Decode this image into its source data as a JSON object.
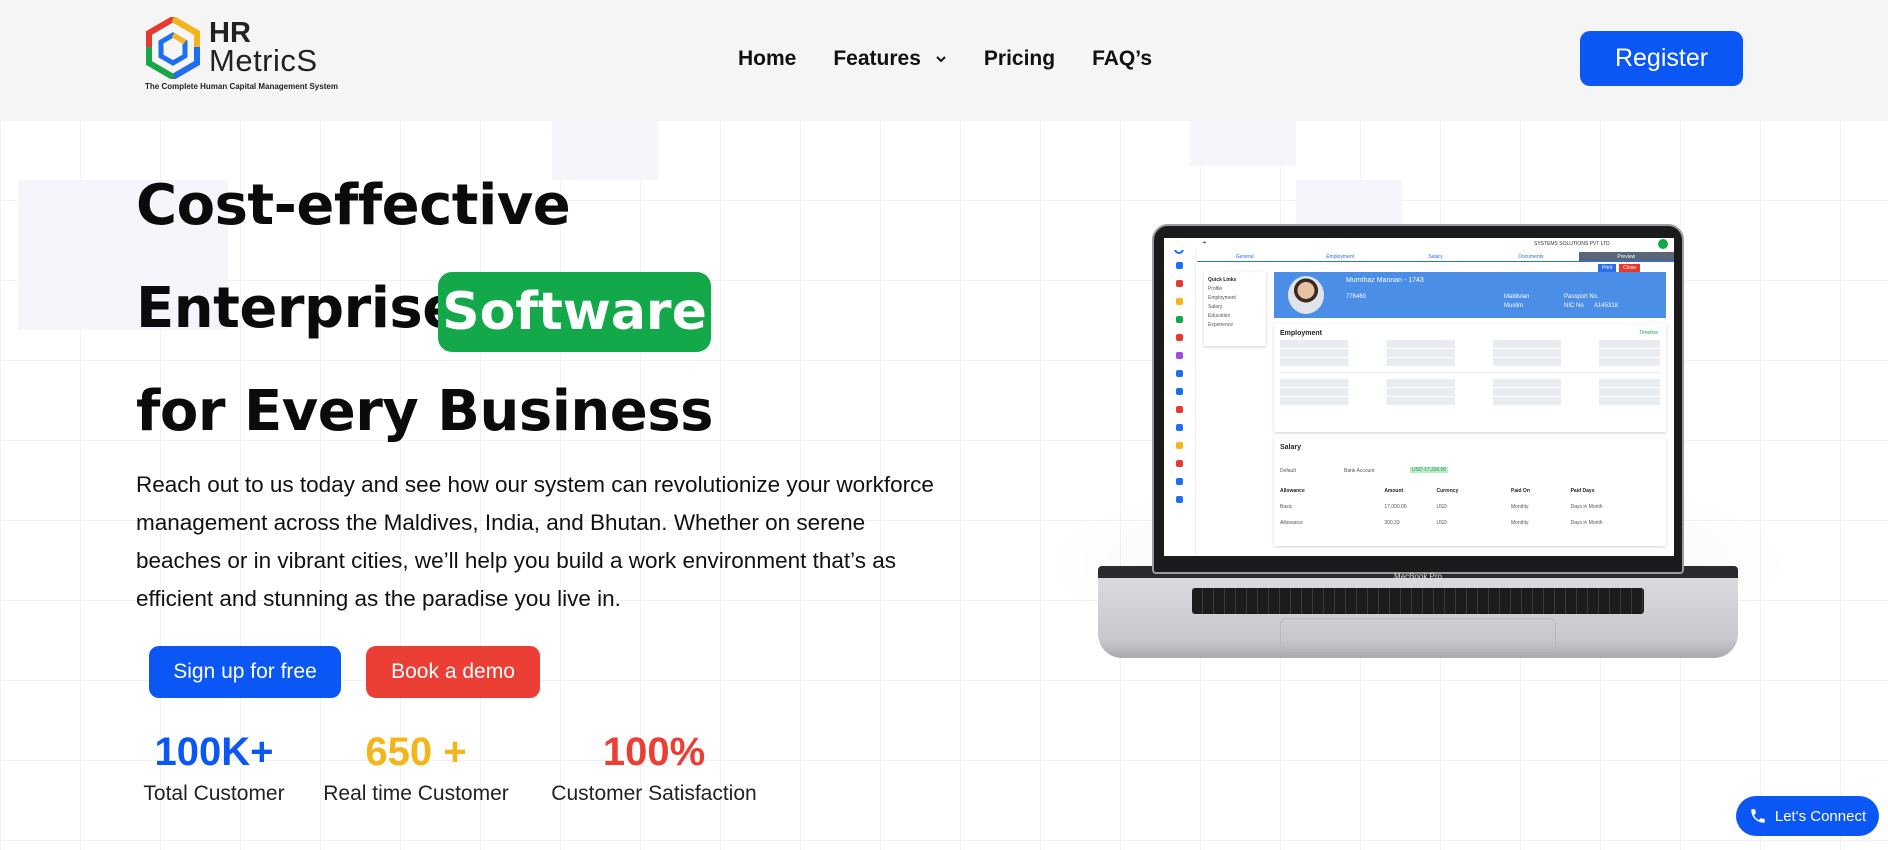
{
  "header": {
    "logo": {
      "hr": "HR",
      "metrics": "MetricS",
      "tagline": "The Complete Human Capital Management System"
    },
    "nav": [
      {
        "label": "Home"
      },
      {
        "label": "Features",
        "has_dropdown": true,
        "icon": "chevron-down-icon"
      },
      {
        "label": "Pricing"
      },
      {
        "label": "FAQ’s"
      }
    ],
    "register_label": "Register"
  },
  "hero": {
    "line1": "Cost-effective",
    "line2_prefix": "Enterprise",
    "line2_highlight": "Software",
    "line3": "for Every Business",
    "description": "Reach out to us today and see how our system can revolutionize your workforce management across the Maldives, India, and Bhutan. Whether on serene beaches or in vibrant cities, we’ll help you build a work environment that’s as efficient and stunning as the paradise you live in.",
    "signup_label": "Sign up for free",
    "demo_label": "Book a demo"
  },
  "stats": [
    {
      "value": "100K+",
      "label": "Total Customer",
      "color": "#0b57f5"
    },
    {
      "value": "650 +",
      "label": "Real time Customer",
      "color": "#f5b41a"
    },
    {
      "value": "100%",
      "label": "Customer Satisfaction",
      "color": "#eb3f35"
    }
  ],
  "laptop": {
    "model_label": "MacBook Pro",
    "screen": {
      "company": "SYSTEMS SOLUTIONS PVT LTD",
      "tabs": [
        "General",
        "Employment",
        "Salary",
        "Documents",
        "Preview"
      ],
      "active_tab": "Preview",
      "print_label": "Print",
      "close_label": "Close",
      "quick_links_title": "Quick Links",
      "quick_links": [
        "Profile",
        "Employment",
        "Salary",
        "Education",
        "Experience"
      ],
      "employee_name": "Mumthaz Mannan - 1743",
      "employee_phone": "776460",
      "employee_nationality": "Maldivian",
      "employee_religion": "Muslim",
      "passport_label": "Passport No.",
      "nic_label": "NIC No",
      "nic_value": "A145318",
      "employment_title": "Employment",
      "timeline_label": "Timeline",
      "salary_title": "Salary",
      "salary_policy": "Default",
      "pay_through": "Bank Account",
      "total_salary": "USD 17,336.00",
      "salary_headers": [
        "Allowance",
        "Amount",
        "Currency",
        "Paid On",
        "Paid Days"
      ],
      "salary_rows": [
        [
          "Basic",
          "17,000.00",
          "USD",
          "Monthly",
          "Days in Month"
        ],
        [
          "Allowance",
          "300.33",
          "USD",
          "Monthly",
          "Days in Month"
        ]
      ]
    }
  },
  "connect_label": "Let's Connect",
  "colors": {
    "primary": "#0b57f5",
    "highlight_green": "#13a94a",
    "demo_red": "#eb3f35",
    "header_bg": "#f5f5f5"
  }
}
